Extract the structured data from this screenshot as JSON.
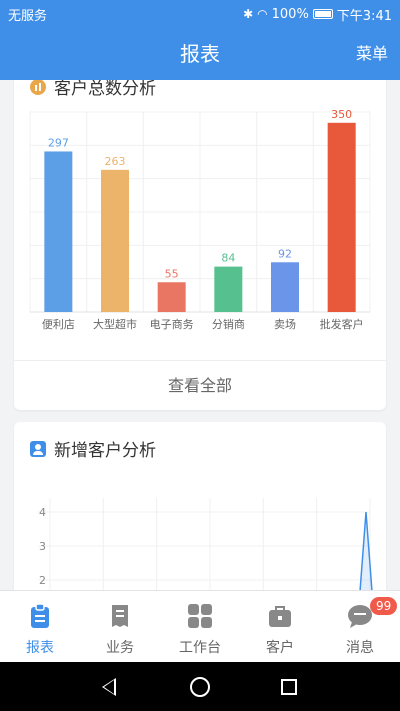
{
  "status_bar": {
    "carrier": "无服务",
    "battery": "100%",
    "time": "下午3:41"
  },
  "header": {
    "title": "报表",
    "menu": "菜单"
  },
  "card1": {
    "title": "客户总数分析",
    "view_all": "查看全部"
  },
  "card2": {
    "title": "新增客户分析"
  },
  "chart_data": [
    {
      "type": "bar",
      "title": "客户总数分析",
      "categories": [
        "便利店",
        "大型超市",
        "电子商务",
        "分销商",
        "卖场",
        "批发客户"
      ],
      "values": [
        297,
        263,
        55,
        84,
        92,
        350
      ],
      "colors": [
        "#5d9fe6",
        "#ecb46a",
        "#e87662",
        "#56c08f",
        "#6b95e8",
        "#e8583a"
      ],
      "grid": true
    },
    {
      "type": "line",
      "title": "新增客户分析",
      "y_ticks": [
        "4",
        "3",
        "2"
      ],
      "ylim": [
        1,
        4.5
      ],
      "line_color": "#3f8fe8",
      "grid": true
    }
  ],
  "tabs": [
    {
      "label": "报表",
      "icon": "clipboard-icon",
      "active": true
    },
    {
      "label": "业务",
      "icon": "document-icon",
      "active": false
    },
    {
      "label": "工作台",
      "icon": "grid-icon",
      "active": false
    },
    {
      "label": "客户",
      "icon": "briefcase-icon",
      "active": false
    },
    {
      "label": "消息",
      "icon": "chat-icon",
      "active": false,
      "badge": "99"
    }
  ]
}
